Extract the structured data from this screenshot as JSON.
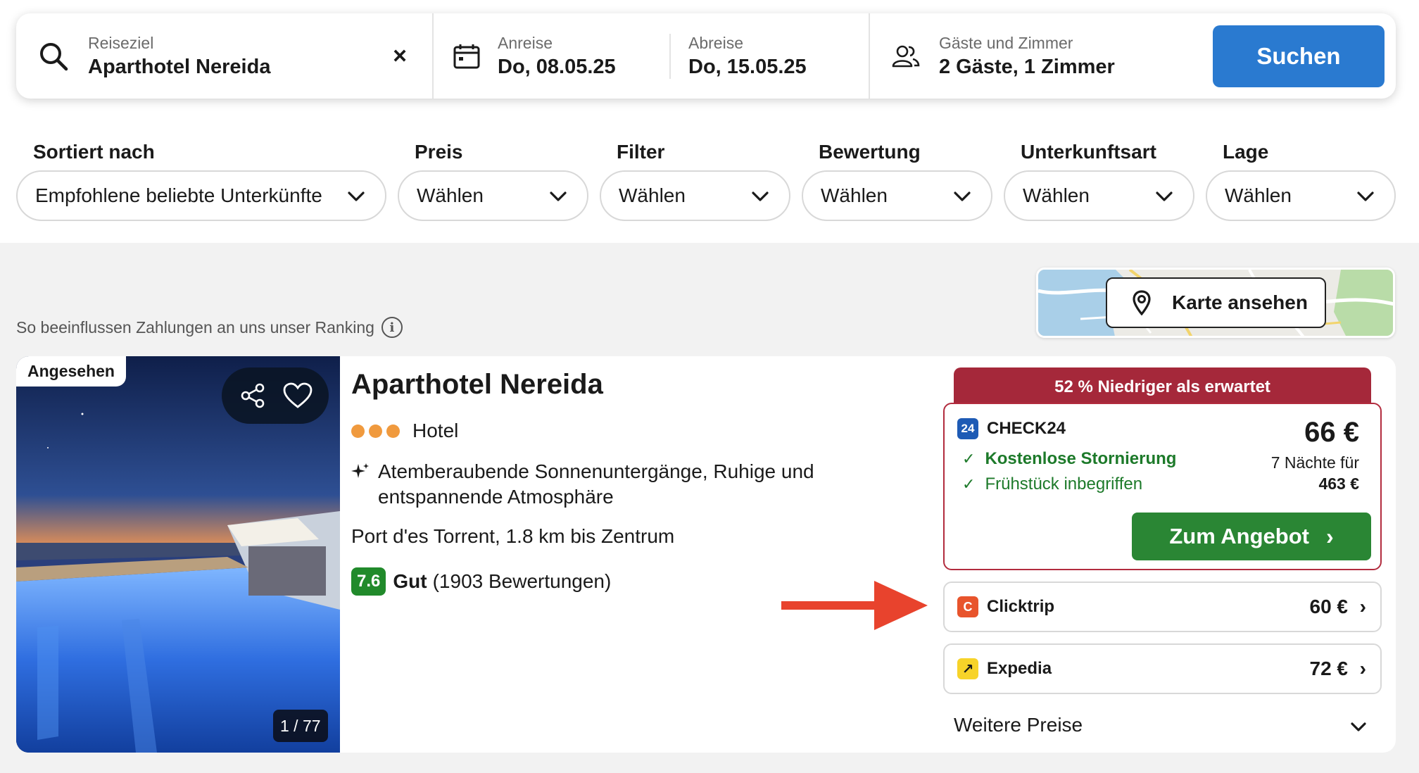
{
  "search": {
    "destination_label": "Reiseziel",
    "destination_value": "Aparthotel Nereida",
    "clear_label": "×",
    "checkin_label": "Anreise",
    "checkin_value": "Do, 08.05.25",
    "checkout_label": "Abreise",
    "checkout_value": "Do, 15.05.25",
    "guests_label": "Gäste und Zimmer",
    "guests_value": "2 Gäste, 1 Zimmer",
    "search_button": "Suchen"
  },
  "filters": [
    {
      "label": "Sortiert nach",
      "value": "Empfohlene beliebte Unterkünfte"
    },
    {
      "label": "Preis",
      "value": "Wählen"
    },
    {
      "label": "Filter",
      "value": "Wählen"
    },
    {
      "label": "Bewertung",
      "value": "Wählen"
    },
    {
      "label": "Unterkunftsart",
      "value": "Wählen"
    },
    {
      "label": "Lage",
      "value": "Wählen"
    }
  ],
  "ranking_note": "So beeinflussen Zahlungen an uns unser Ranking",
  "map_button": "Karte ansehen",
  "hotel": {
    "seen_badge": "Angesehen",
    "photo_counter": "1 / 77",
    "name": "Aparthotel Nereida",
    "stars": 3,
    "type": "Hotel",
    "highlights": "Atemberaubende Sonnenuntergänge, Ruhige und entspannende Atmosphäre",
    "location": "Port d'es Torrent, 1.8 km bis Zentrum",
    "rating_score": "7.6",
    "rating_word": "Gut",
    "rating_count": "(1903 Bewertungen)"
  },
  "deal": {
    "banner": "52 % Niedriger als erwartet",
    "provider": "CHECK24",
    "benefit_1": "Kostenlose Stornierung",
    "benefit_2": "Frühstück inbegriffen",
    "price": "66 €",
    "nights": "7 Nächte für",
    "total": "463 €",
    "offer_button": "Zum Angebot"
  },
  "other_providers": [
    {
      "name": "Clicktrip",
      "price": "60 €"
    },
    {
      "name": "Expedia",
      "price": "72 €"
    }
  ],
  "more_prices": "Weitere Preise",
  "colors": {
    "search_blue": "#2a7ad0",
    "deal_red": "#a5283a",
    "offer_green": "#2a8634",
    "rating_green": "#218a2b",
    "star_orange": "#f09a3e",
    "annotation_arrow": "#e8432d"
  }
}
